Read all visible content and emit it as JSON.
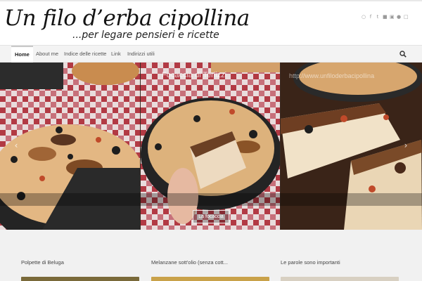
{
  "header": {
    "site_title": "Un filo d’erba cipollina",
    "tagline": "...per legare pensieri e ricette",
    "social_icons": [
      "rss-icon",
      "facebook-icon",
      "twitter-icon",
      "flickr-icon",
      "instagram-icon",
      "pinterest-icon",
      "email-icon"
    ]
  },
  "nav": {
    "items": [
      {
        "label": "Home",
        "active": true
      },
      {
        "label": "About me",
        "active": false
      },
      {
        "label": "Indice delle ricette",
        "active": false
      },
      {
        "label": "Link",
        "active": false
      },
      {
        "label": "Indirizzi utili",
        "active": false
      }
    ],
    "search_icon": "search-icon"
  },
  "slider": {
    "caption": "Focaccia di Terlizzi",
    "watermark": "http://www.unfiloderbacipollina",
    "button_label": "La focaccia",
    "prev_icon": "‹",
    "next_icon": "›"
  },
  "posts": [
    {
      "title": "Polpette di Beluga"
    },
    {
      "title": "Melanzane sott'olio (senza cott..."
    },
    {
      "title": "Le parole sono importanti"
    }
  ],
  "colors": {
    "header_bg": "#ffffff",
    "nav_bg": "#f3f3f3",
    "accent": "#c9a24a"
  }
}
